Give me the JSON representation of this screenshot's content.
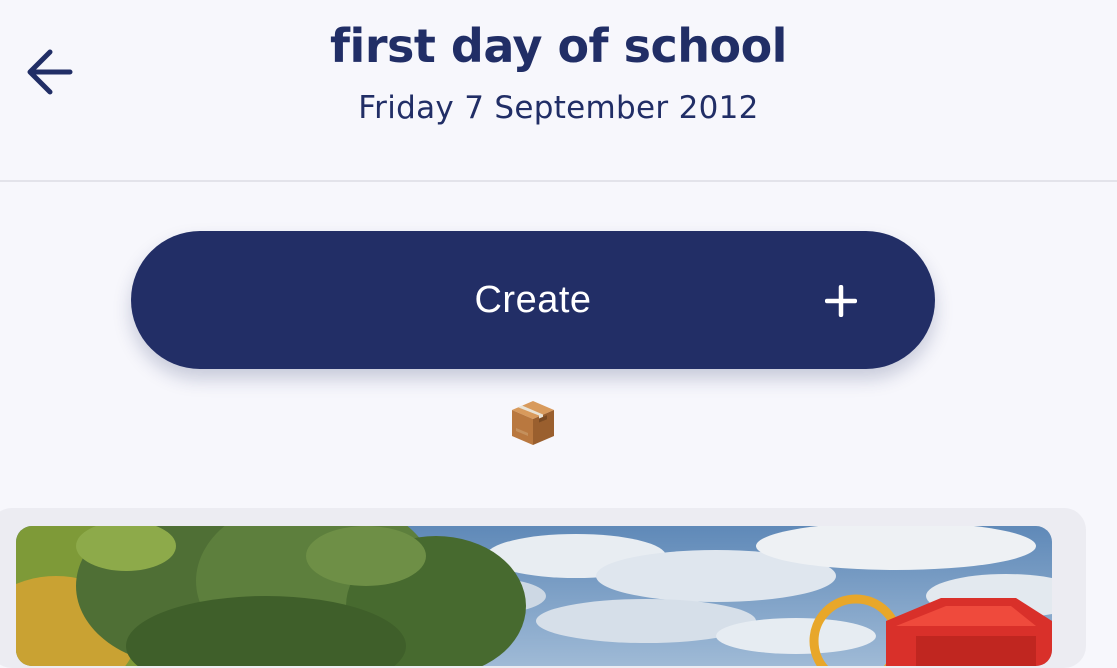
{
  "header": {
    "title": "first day of school",
    "date": "Friday 7 September 2012",
    "back_icon": "arrow-left-icon"
  },
  "actions": {
    "create_label": "Create",
    "create_icon": "plus-icon"
  },
  "empty_state": {
    "icon": "package-box-icon"
  },
  "photo_card": {
    "description_icon": "playground-photo"
  },
  "colors": {
    "accent": "#222e66",
    "background": "#f7f7fc",
    "button_text": "#ffffff"
  }
}
